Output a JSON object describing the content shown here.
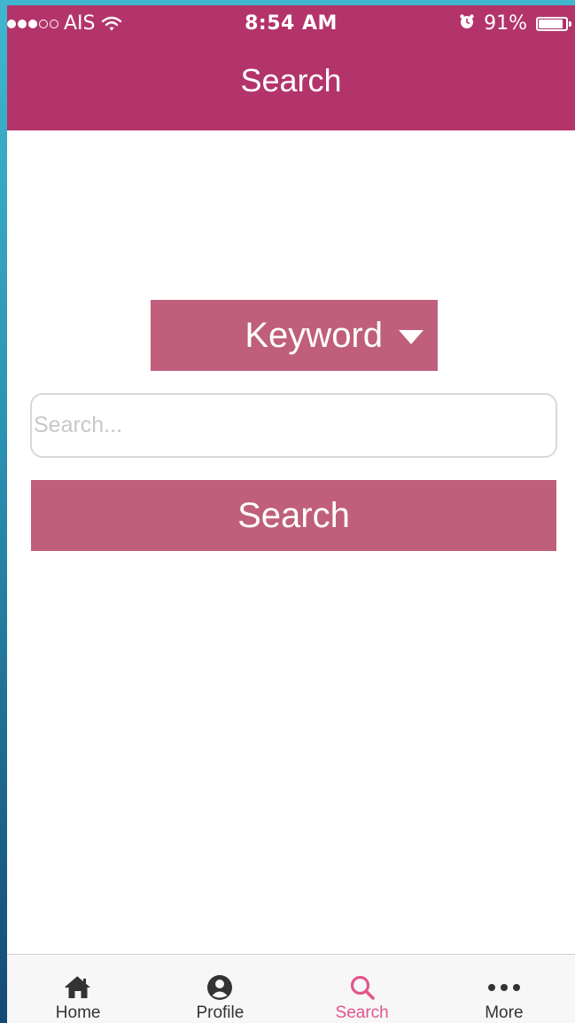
{
  "status_bar": {
    "carrier": "AIS",
    "time": "8:54 AM",
    "battery": "91%",
    "battery_level": 0.91
  },
  "header": {
    "title": "Search"
  },
  "filter": {
    "selected": "Keyword"
  },
  "search": {
    "placeholder": "Search...",
    "value": "",
    "button_label": "Search"
  },
  "tabs": [
    {
      "label": "Home",
      "icon": "home-icon",
      "active": false
    },
    {
      "label": "Profile",
      "icon": "profile-icon",
      "active": false
    },
    {
      "label": "Search",
      "icon": "search-icon",
      "active": true
    },
    {
      "label": "More",
      "icon": "more-icon",
      "active": false
    }
  ],
  "colors": {
    "header_bg": "#b3346a",
    "button_bg": "#bf5f7b",
    "active_tab": "#e0578b"
  }
}
